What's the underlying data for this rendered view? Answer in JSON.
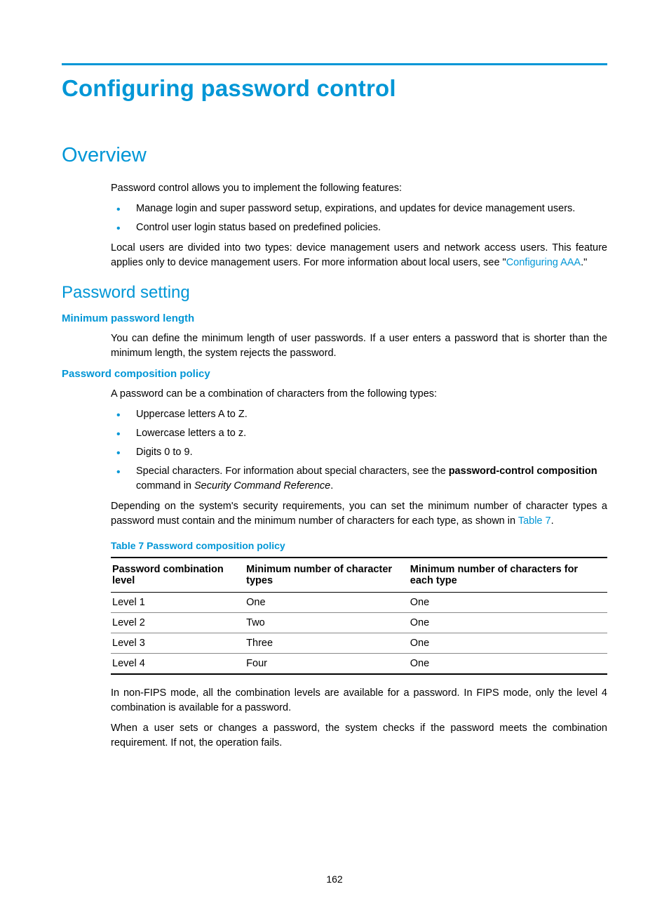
{
  "title": "Configuring password control",
  "overview": {
    "heading": "Overview",
    "intro": "Password control allows you to implement the following features:",
    "bullets": [
      "Manage login and super password setup, expirations, and updates for device management users.",
      "Control user login status based on predefined policies."
    ],
    "para2_prefix": "Local users are divided into two types: device management users and network access users. This feature applies only to device management users. For more information about local users, see \"",
    "para2_link": "Configuring AAA",
    "para2_suffix": ".\""
  },
  "password_setting": {
    "heading": "Password setting",
    "min_len": {
      "heading": "Minimum password length",
      "para": "You can define the minimum length of user passwords. If a user enters a password that is shorter than the minimum length, the system rejects the password."
    },
    "composition": {
      "heading": "Password composition policy",
      "intro": "A password can be a combination of characters from the following types:",
      "bullets": {
        "b1": "Uppercase letters A to Z.",
        "b2": "Lowercase letters a to z.",
        "b3": "Digits 0 to 9.",
        "b4_prefix": "Special characters. For information about special characters, see the ",
        "b4_bold": "password-control composition",
        "b4_mid": " command in ",
        "b4_em": "Security Command Reference",
        "b4_suffix": "."
      },
      "para2_prefix": "Depending on the system's security requirements, you can set the minimum number of character types a password must contain and the minimum number of characters for each type, as shown in ",
      "para2_link": "Table 7",
      "para2_suffix": ".",
      "table_caption": "Table 7 Password composition policy",
      "table": {
        "headers": {
          "h1": "Password combination level",
          "h2": "Minimum number of character types",
          "h3": "Minimum number of characters for each type"
        },
        "rows": [
          {
            "level": "Level 1",
            "types": "One",
            "chars": "One"
          },
          {
            "level": "Level 2",
            "types": "Two",
            "chars": "One"
          },
          {
            "level": "Level 3",
            "types": "Three",
            "chars": "One"
          },
          {
            "level": "Level 4",
            "types": "Four",
            "chars": "One"
          }
        ]
      },
      "after1": "In non-FIPS mode, all the combination levels are available for a password. In FIPS mode, only the level 4 combination is available for a password.",
      "after2": "When a user sets or changes a password, the system checks if the password meets the combination requirement. If not, the operation fails."
    }
  },
  "page_number": "162"
}
